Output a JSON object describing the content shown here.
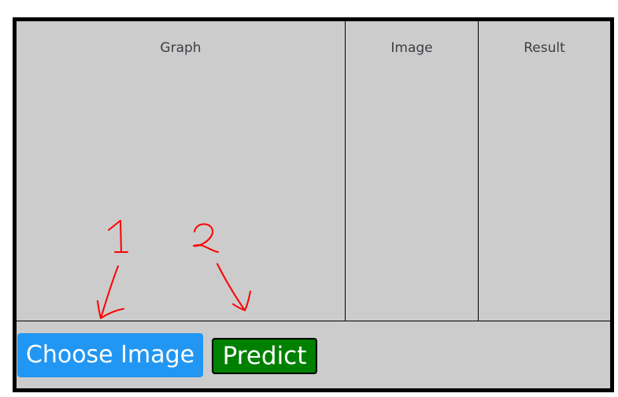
{
  "panels": {
    "graph": "Graph",
    "image": "Image",
    "result": "Result"
  },
  "buttons": {
    "choose_image": "Choose Image",
    "predict": "Predict"
  },
  "annotations": {
    "step1": "1",
    "step2": "2",
    "color": "#ff0000"
  },
  "colors": {
    "choose_button": "#2196f3",
    "predict_button": "#008000",
    "panel_background": "#cccccc"
  }
}
